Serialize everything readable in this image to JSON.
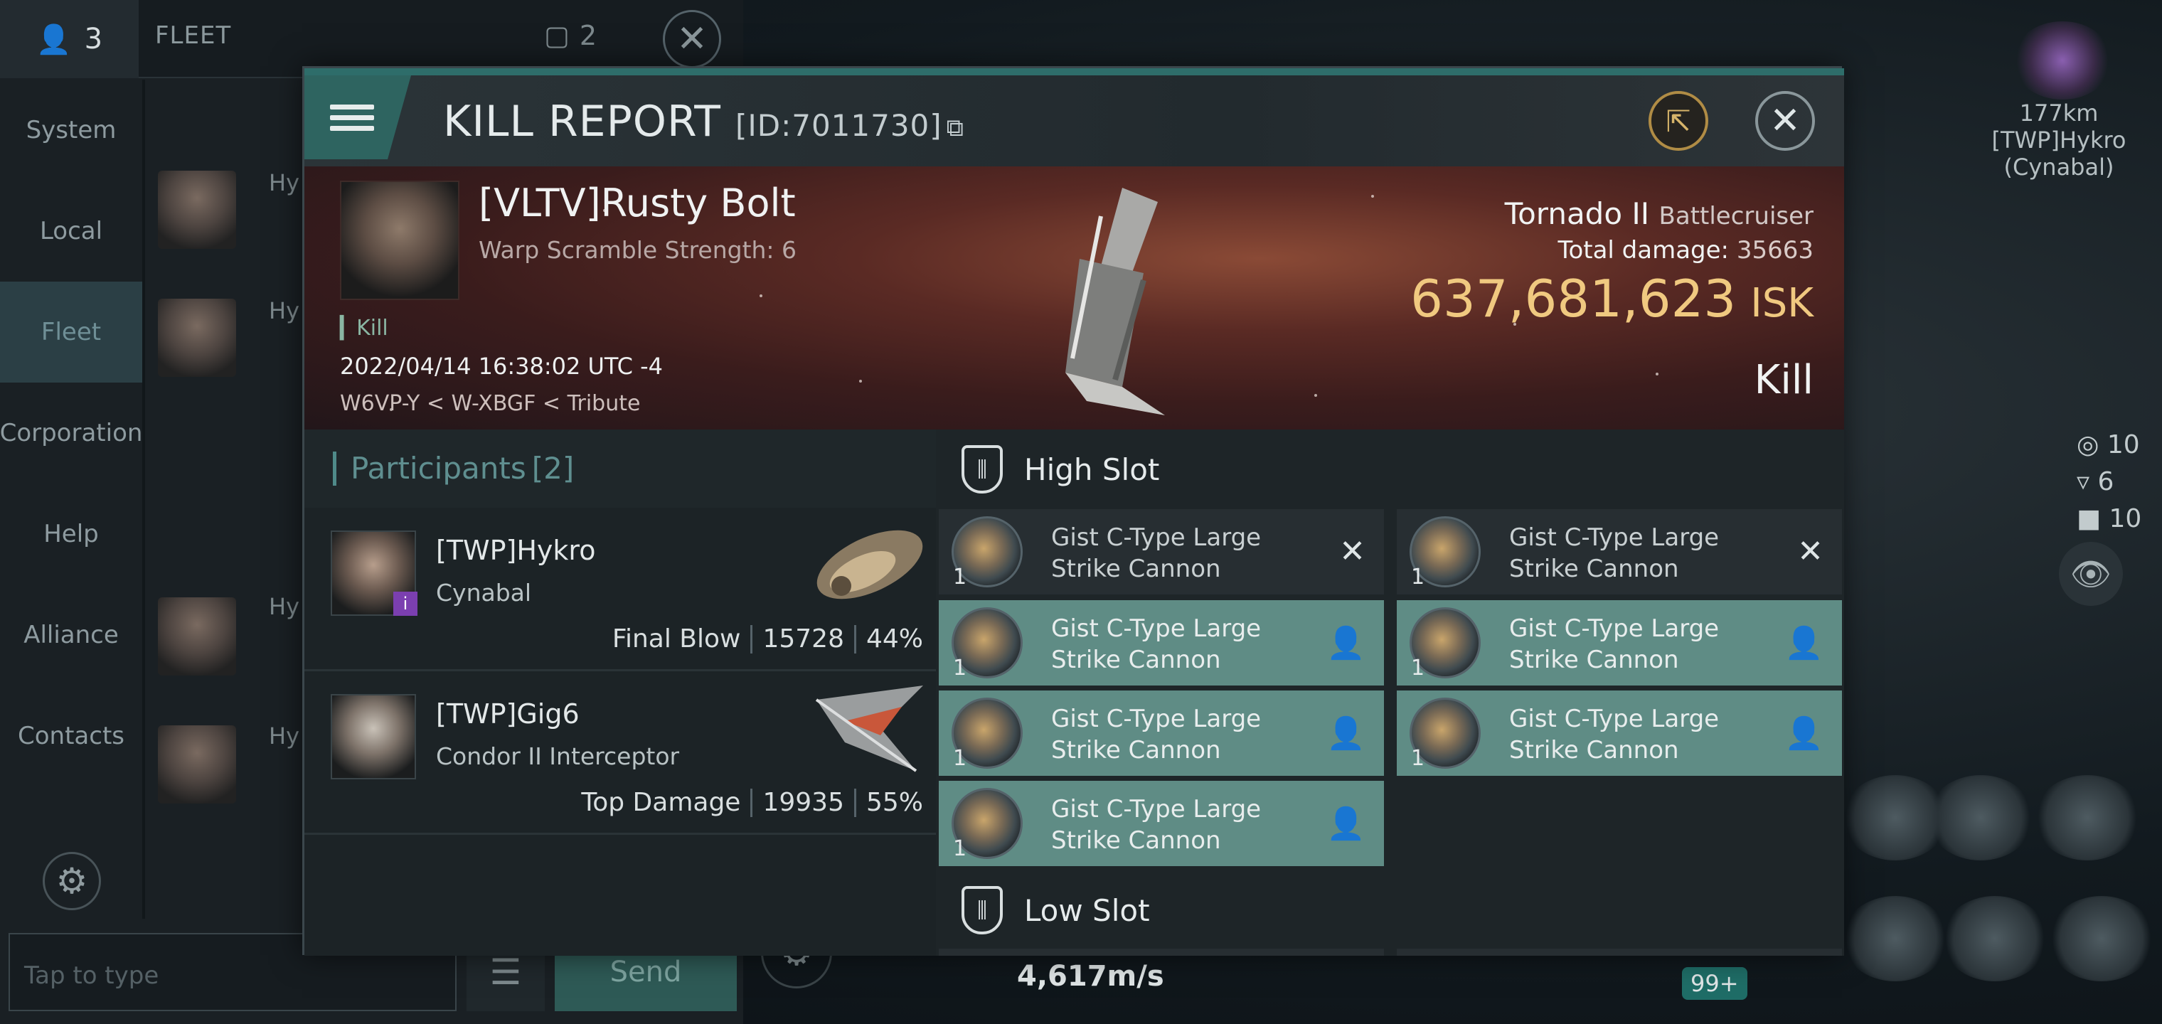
{
  "chat": {
    "member_count": "3",
    "tab_label": "FLEET",
    "fleet_window_count": "2",
    "nav": [
      "System",
      "Local",
      "Fleet",
      "Corporation",
      "Help",
      "Alliance",
      "Contacts"
    ],
    "active_nav": "Fleet",
    "input_placeholder": "Tap to type",
    "send_label": "Send",
    "partial_names": [
      "Hy",
      "Hy",
      "Hy",
      "Hy"
    ]
  },
  "hud": {
    "target_distance": "177km",
    "target_name": "[TWP]Hykro",
    "target_ship": "(Cynabal)",
    "stats": [
      "10",
      "6",
      "10"
    ],
    "speed": "4,617m/s",
    "badge": "99+"
  },
  "report": {
    "title": "KILL REPORT",
    "id": "[ID:7011730]",
    "victim": {
      "name": "[VLTV]Rusty Bolt",
      "sub": "Warp Scramble Strength: 6",
      "tag": "Kill",
      "time": "2022/04/14 16:38:02 UTC -4",
      "location": "W6VP-Y < W-XBGF < Tribute"
    },
    "ship": {
      "name": "Tornado II",
      "class": "Battlecruiser",
      "damage_label": "Total damage:",
      "damage_value": "35663",
      "isk_value": "637,681,623",
      "isk_unit": "ISK",
      "result": "Kill"
    },
    "participants": {
      "label": "Participants",
      "count": "[2]",
      "rows": [
        {
          "name": "[TWP]Hykro",
          "ship": "Cynabal",
          "role": "Final Blow",
          "damage": "15728",
          "percent": "44%"
        },
        {
          "name": "[TWP]Gig6",
          "ship": "Condor II Interceptor",
          "role": "Top Damage",
          "damage": "19935",
          "percent": "55%"
        }
      ]
    },
    "slots": {
      "high_label": "High Slot",
      "low_label": "Low Slot",
      "modules": [
        {
          "name_line1": "Gist C-Type Large",
          "name_line2": "Strike Cannon",
          "qty": "1",
          "state": "destroyed"
        },
        {
          "name_line1": "Gist C-Type Large",
          "name_line2": "Strike Cannon",
          "qty": "1",
          "state": "destroyed"
        },
        {
          "name_line1": "Gist C-Type Large",
          "name_line2": "Strike Cannon",
          "qty": "1",
          "state": "dropped"
        },
        {
          "name_line1": "Gist C-Type Large",
          "name_line2": "Strike Cannon",
          "qty": "1",
          "state": "dropped"
        },
        {
          "name_line1": "Gist C-Type Large",
          "name_line2": "Strike Cannon",
          "qty": "1",
          "state": "dropped"
        },
        {
          "name_line1": "Gist C-Type Large",
          "name_line2": "Strike Cannon",
          "qty": "1",
          "state": "dropped"
        },
        {
          "name_line1": "Gist C-Type Large",
          "name_line2": "Strike Cannon",
          "qty": "1",
          "state": "dropped"
        }
      ]
    }
  },
  "icons": {
    "menu": "menu-icon",
    "share": "share-icon",
    "close": "close-icon",
    "copy": "copy-icon",
    "destroyed": "x-icon",
    "dropped": "person-icon",
    "slot": "shield-icon"
  },
  "colors": {
    "accent": "#2e6d6a",
    "isk": "#f0c980",
    "dropped_row": "#5f8c85"
  }
}
